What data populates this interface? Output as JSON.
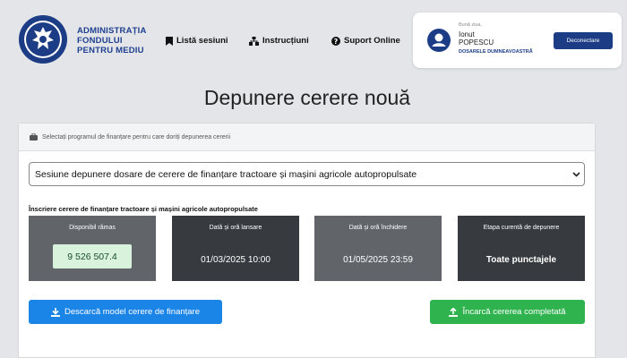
{
  "org": {
    "lines": [
      "ADMINISTRAȚIA",
      "FONDULUI",
      "PENTRU MEDIU"
    ]
  },
  "nav": {
    "sessions": "Listă sesiuni",
    "instructions": "Instrucțiuni",
    "support": "Suport Online"
  },
  "user": {
    "greeting": "Bună ziua,",
    "first_name": "Ionut",
    "last_name": "POPESCU",
    "folders_link": "DOSARELE DUMNEAVOASTRĂ",
    "logout_label": "Deconectare"
  },
  "page": {
    "title": "Depunere cerere nouă"
  },
  "program": {
    "header_text": "Selectați programul de finanțare pentru care doriți depunerea cererii",
    "selected_option": "Sesiune depunere dosare de cerere de finanțare tractoare și mașini agricole autopropulsate",
    "section_label": "Înscriere cerere de finanțare tractoare și mașini agricole autopropulsate"
  },
  "stats": {
    "available": {
      "label": "Disponibil rămas",
      "value": "9 526 507.4"
    },
    "launch": {
      "label": "Dată și oră lansare",
      "value": "01/03/2025 10:00"
    },
    "close": {
      "label": "Dată și oră închidere",
      "value": "01/05/2025 23:59"
    },
    "stage": {
      "label": "Etapa curentă de depunere",
      "value": "Toate punctajele"
    }
  },
  "actions": {
    "download_label": "Descarcă model cerere de finanțare",
    "upload_label": "Încarcă cererea completată"
  },
  "colors": {
    "brand_navy": "#1c3d86",
    "download_blue": "#1b84e7",
    "upload_green": "#2fb34f",
    "available_pill": "#d9f2dc"
  }
}
